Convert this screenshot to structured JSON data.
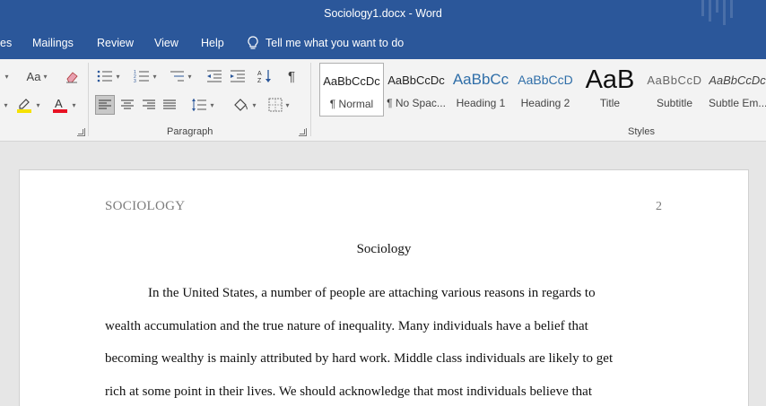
{
  "window": {
    "title": "Sociology1.docx  -  Word"
  },
  "menu": {
    "tabs": [
      "es",
      "Mailings",
      "Review",
      "View",
      "Help"
    ],
    "tell_me": "Tell me what you want to do"
  },
  "ribbon": {
    "font_group": {
      "change_case": "Aa",
      "highlight_color": "#f5e100",
      "font_color": "#e81123"
    },
    "paragraph_group": {
      "label": "Paragraph"
    },
    "styles_group": {
      "label": "Styles",
      "items": [
        {
          "preview": "AaBbCcDc",
          "name": "¶ Normal"
        },
        {
          "preview": "AaBbCcDc",
          "name": "¶ No Spac..."
        },
        {
          "preview": "AaBbCc",
          "name": "Heading 1"
        },
        {
          "preview": "AaBbCcD",
          "name": "Heading 2"
        },
        {
          "preview": "AaB",
          "name": "Title"
        },
        {
          "preview": "AaBbCcD",
          "name": "Subtitle"
        },
        {
          "preview": "AaBbCcDc",
          "name": "Subtle Em..."
        }
      ]
    }
  },
  "document": {
    "header_left": "SOCIOLOGY",
    "page_number": "2",
    "title": "Sociology",
    "lines": [
      "In the United States, a number of people are attaching various reasons in regards to",
      "wealth accumulation and the true nature of inequality. Many individuals have a belief that",
      "becoming wealthy is mainly attributed by hard work. Middle class individuals are likely to get",
      "rich at some point in their lives. We should acknowledge that most individuals believe that"
    ]
  }
}
